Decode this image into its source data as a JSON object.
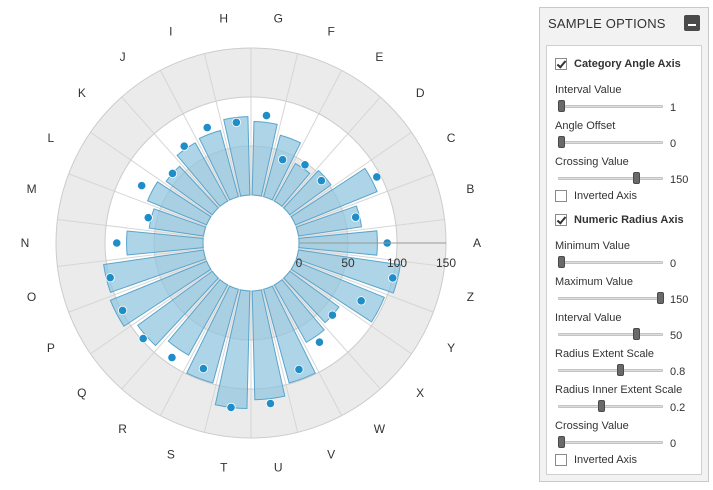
{
  "chart_data": {
    "type": "polar-area",
    "categories": [
      "A",
      "B",
      "C",
      "D",
      "E",
      "F",
      "G",
      "H",
      "I",
      "J",
      "K",
      "L",
      "M",
      "N",
      "O",
      "P",
      "Q",
      "R",
      "S",
      "T",
      "U",
      "V",
      "W",
      "X",
      "Y",
      "Z"
    ],
    "series": [
      {
        "values": [
          80,
          65,
          90,
          52,
          44,
          65,
          75,
          80,
          70,
          68,
          58,
          65,
          56,
          78,
          103,
          106,
          94,
          82,
          99,
          120,
          111,
          99,
          67,
          62,
          98,
          105
        ]
      }
    ],
    "marker_values": [
      90,
      61,
      96,
      47,
      48,
      42,
      82,
      75,
      77,
      71,
      58,
      77,
      59,
      88,
      99,
      99,
      98,
      93,
      88,
      120,
      116,
      89,
      74,
      62,
      78,
      100
    ],
    "angle_axis": {
      "interval": 1,
      "angle_offset": 0,
      "crossing_value": 150,
      "inverted": false
    },
    "radius_axis": {
      "min": 0,
      "max": 150,
      "interval": 50,
      "extent_scale": 0.8,
      "inner_extent_scale": 0.2,
      "crossing_value": 0,
      "inverted": false,
      "tick_labels": [
        "0",
        "50",
        "100",
        "150"
      ]
    },
    "colors": {
      "bar_fill": "#8ec4de",
      "bar_stroke": "#5aa5cc",
      "marker": "#1f8dc8",
      "band": "#ebebeb",
      "grid": "#cccccc"
    }
  },
  "panel": {
    "title": "SAMPLE OPTIONS",
    "category_angle_axis": {
      "label": "Category Angle Axis",
      "checked": true,
      "interval": {
        "label": "Interval Value",
        "value": "1",
        "fraction": 0.0
      },
      "angle_offset": {
        "label": "Angle Offset",
        "value": "0",
        "fraction": 0.0
      },
      "crossing": {
        "label": "Crossing Value",
        "value": "150",
        "fraction": 0.76
      },
      "inverted": {
        "label": "Inverted Axis",
        "checked": false
      }
    },
    "numeric_radius_axis": {
      "label": "Numeric Radius Axis",
      "checked": true,
      "minimum": {
        "label": "Minimum Value",
        "value": "0",
        "fraction": 0.0
      },
      "maximum": {
        "label": "Maximum Value",
        "value": "150",
        "fraction": 1.0
      },
      "interval": {
        "label": "Interval Value",
        "value": "50",
        "fraction": 0.76
      },
      "extent_scale": {
        "label": "Radius Extent Scale",
        "value": "0.8",
        "fraction": 0.6
      },
      "inner_extent_scale": {
        "label": "Radius Inner Extent Scale",
        "value": "0.2",
        "fraction": 0.4
      },
      "crossing": {
        "label": "Crossing Value",
        "value": "0",
        "fraction": 0.0
      },
      "inverted": {
        "label": "Inverted Axis",
        "checked": false
      }
    }
  }
}
